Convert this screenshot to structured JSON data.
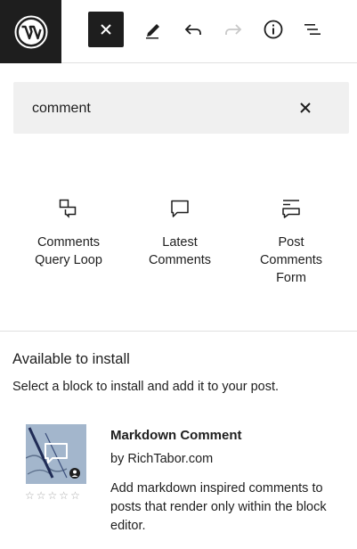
{
  "toolbar": {
    "logo_icon": "wordpress-logo-icon",
    "close_icon": "close-icon",
    "tools_icon": "pencil-icon",
    "undo_icon": "undo-icon",
    "redo_icon": "redo-icon",
    "info_icon": "info-icon",
    "list_view_icon": "list-view-icon"
  },
  "search": {
    "value": "comment",
    "clear_icon": "close-icon"
  },
  "blocks": [
    {
      "label_line1": "Comments",
      "label_line2": "Query Loop",
      "icon": "comments-query-loop-icon"
    },
    {
      "label_line1": "Latest",
      "label_line2": "Comments",
      "icon": "comment-bubble-icon"
    },
    {
      "label_line1": "Post",
      "label_line2": "Comments",
      "label_line3": "Form",
      "icon": "post-comments-form-icon"
    }
  ],
  "available": {
    "title": "Available to install",
    "description": "Select a block to install and add it to your post."
  },
  "plugin": {
    "name": "Markdown Comment",
    "author": "by RichTabor.com",
    "description": "Add markdown inspired comments to posts that render only within the block editor.",
    "rating_stars": 0,
    "rating_max": 5
  },
  "colors": {
    "dark": "#1e1e1e",
    "search_bg": "#f0f0f0",
    "border": "#e0e0e0"
  }
}
